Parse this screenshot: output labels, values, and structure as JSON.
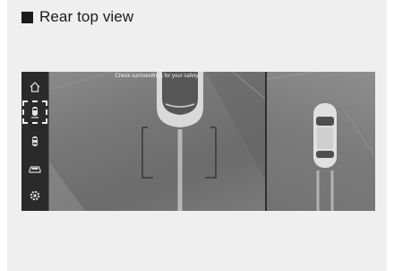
{
  "section": {
    "title": "Rear top view"
  },
  "screen": {
    "notice": "Check surroundings for your safety.",
    "sidebar": [
      {
        "name": "home",
        "icon": "home-icon"
      },
      {
        "name": "rear-top-view",
        "icon": "rear-top-view-icon",
        "selected": true
      },
      {
        "name": "car-view",
        "icon": "car-top-view-icon"
      },
      {
        "name": "car-side",
        "icon": "car-side-icon"
      },
      {
        "name": "settings",
        "icon": "gear-icon"
      }
    ]
  },
  "colors": {
    "screen_bg": "#3a3a3a",
    "selection": "#f2f2f2"
  }
}
